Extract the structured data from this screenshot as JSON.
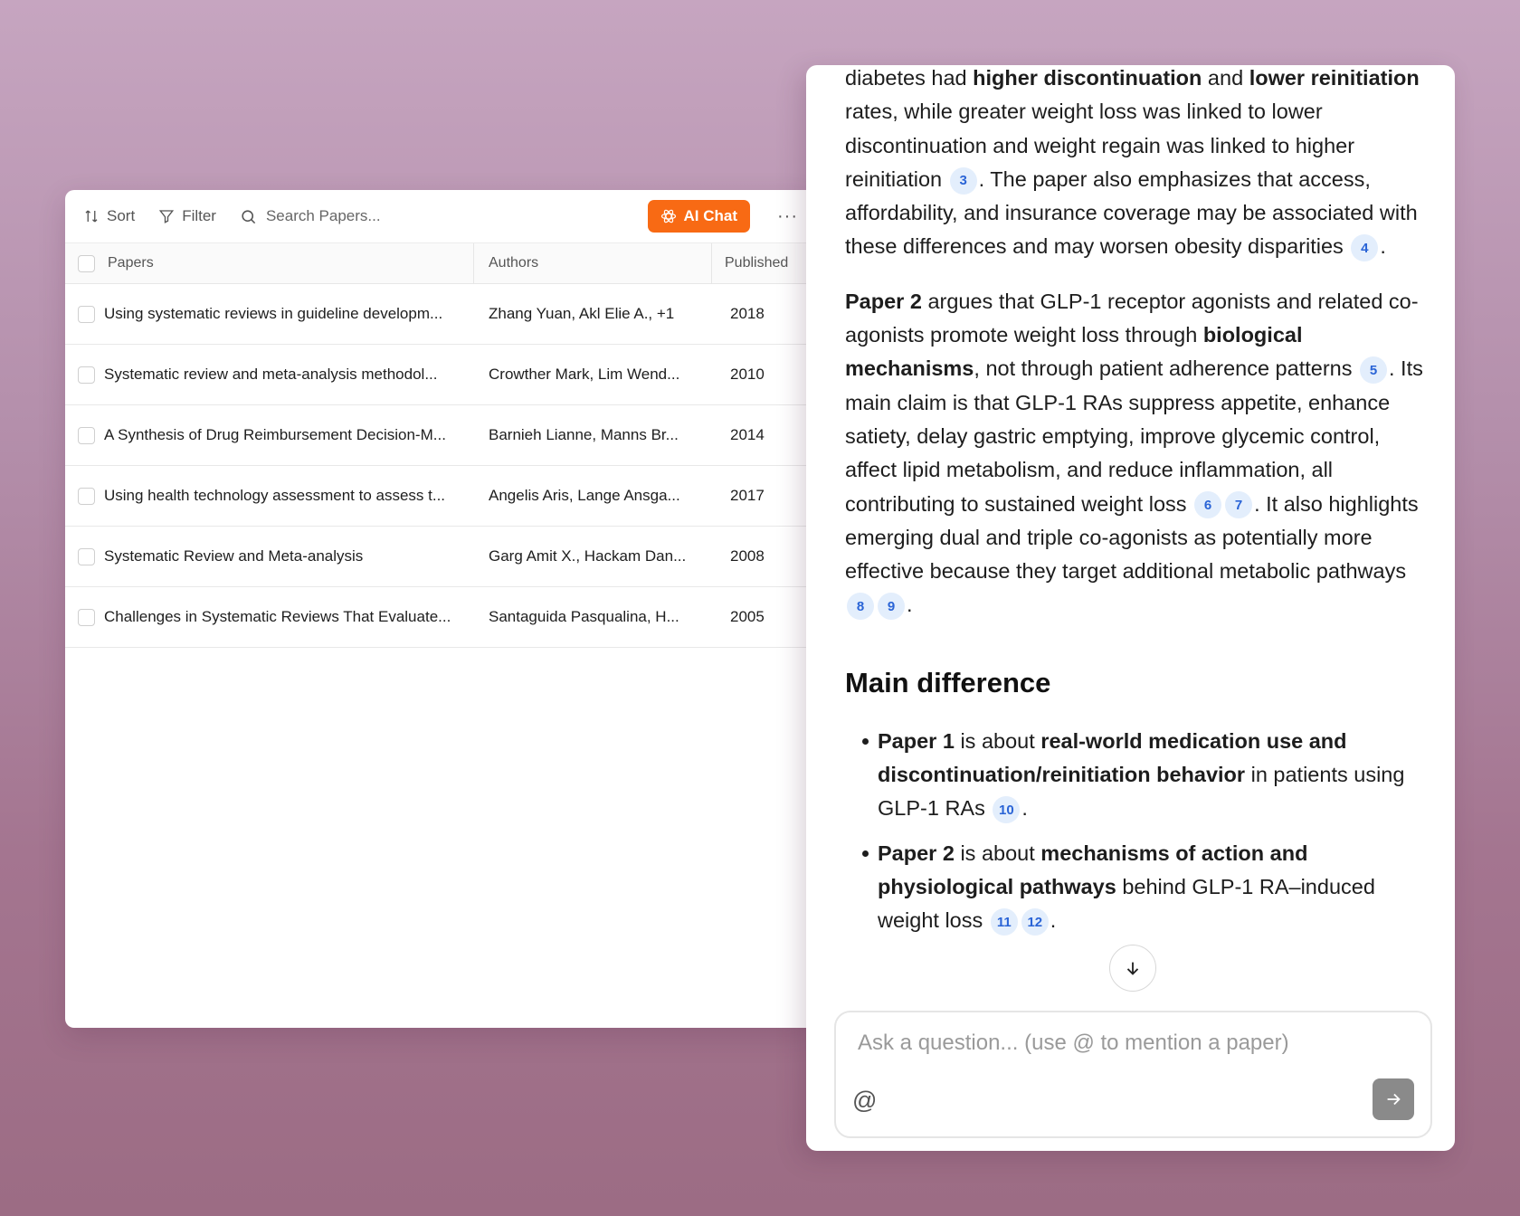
{
  "toolbar": {
    "sort_label": "Sort",
    "filter_label": "Filter",
    "search_placeholder": "Search Papers...",
    "ai_chat_label": "AI Chat",
    "more_label": "···",
    "accent_color": "#f86a14"
  },
  "table": {
    "columns": {
      "papers": "Papers",
      "authors": "Authors",
      "published": "Published"
    },
    "rows": [
      {
        "title": "Using systematic reviews in guideline developm...",
        "authors": "Zhang Yuan, Akl Elie A., +1",
        "year": "2018"
      },
      {
        "title": "Systematic review and meta-analysis methodol...",
        "authors": "Crowther Mark, Lim Wend...",
        "year": "2010"
      },
      {
        "title": "A Synthesis of Drug Reimbursement Decision-M...",
        "authors": "Barnieh Lianne, Manns Br...",
        "year": "2014"
      },
      {
        "title": "Using health technology assessment to assess t...",
        "authors": "Angelis Aris, Lange Ansga...",
        "year": "2017"
      },
      {
        "title": "Systematic Review and Meta-analysis",
        "authors": "Garg Amit X., Hackam Dan...",
        "year": "2008"
      },
      {
        "title": "Challenges in Systematic Reviews That Evaluate...",
        "authors": "Santaguida Pasqualina, H...",
        "year": "2005"
      }
    ]
  },
  "chat": {
    "p1": {
      "t1": "diabetes had ",
      "b1": "higher discontinuation",
      "t2": " and ",
      "b2": "lower reinitiation",
      "t3": " rates, while greater weight loss was linked to lower discontinuation and weight regain was linked to higher reinitiation ",
      "c1": "3",
      "t4": ". The paper also emphasizes that access, affordability, and insurance coverage may be associated with these differences and may worsen obesity disparities ",
      "c2": "4",
      "t5": "."
    },
    "p2": {
      "b1": "Paper 2",
      "t1": " argues that GLP-1 receptor agonists and related co-agonists promote weight loss through ",
      "b2": "biological mechanisms",
      "t2": ", not through patient adherence patterns ",
      "c1": "5",
      "t3": ". Its main claim is that GLP-1 RAs suppress appetite, enhance satiety, delay gastric emptying, improve glycemic control, affect lipid metabolism, and reduce inflammation, all contributing to sustained weight loss ",
      "c2": "6",
      "c3": "7",
      "t4": ". It also highlights emerging dual and triple co-agonists as potentially more effective because they target additional metabolic pathways ",
      "c4": "8",
      "c5": "9",
      "t5": "."
    },
    "section_title": "Main difference",
    "bullet1": {
      "b1": "Paper 1",
      "t1": " is about ",
      "b2": "real-world medication use and discontinuation/reinitiation behavior",
      "t2": " in patients using GLP-1 RAs ",
      "c1": "10",
      "t3": "."
    },
    "bullet2": {
      "b1": "Paper 2",
      "t1": " is about ",
      "b2": "mechanisms of action and physiological pathways",
      "t2": " behind GLP-1 RA–induced weight loss ",
      "c1": "11",
      "c2": "12",
      "t3": "."
    }
  },
  "composer": {
    "placeholder": "Ask a question... (use @ to mention a paper)",
    "mention_label": "@"
  }
}
